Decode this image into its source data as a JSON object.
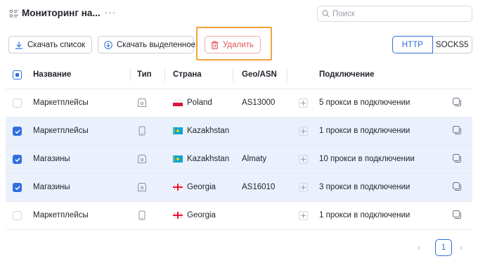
{
  "header": {
    "title": "Мониторинг на...",
    "more": "···",
    "search_placeholder": "Поиск"
  },
  "toolbar": {
    "download_list": "Скачать список",
    "download_selected": "Скачать выделенное",
    "delete": "Удалить",
    "protocols": [
      "HTTP",
      "SOCKS5"
    ],
    "active_protocol": "HTTP"
  },
  "table": {
    "columns": {
      "name": "Название",
      "type": "Тип",
      "country": "Страна",
      "geo": "Geo/ASN",
      "connection": "Подключение"
    },
    "rows": [
      {
        "name": "Маркетплейсы",
        "type_icon": "router-icon",
        "country": "Poland",
        "flag": "poland-flag-icon",
        "geo": "AS13000",
        "connection": "5 прокси в подключении",
        "selected": false
      },
      {
        "name": "Маркетплейсы",
        "type_icon": "mobile-icon",
        "country": "Kazakhstan",
        "flag": "kazakhstan-flag-icon",
        "geo": "",
        "connection": "1 прокси в подключении",
        "selected": true
      },
      {
        "name": "Магазины",
        "type_icon": "router-icon",
        "country": "Kazakhstan",
        "flag": "kazakhstan-flag-icon",
        "geo": "Almaty",
        "connection": "10 прокси в подключении",
        "selected": true
      },
      {
        "name": "Магазины",
        "type_icon": "router-icon",
        "country": "Georgia",
        "flag": "georgia-flag-icon",
        "geo": "AS16010",
        "connection": "3 прокси в подключении",
        "selected": true
      },
      {
        "name": "Маркетплейсы",
        "type_icon": "mobile-icon",
        "country": "Georgia",
        "flag": "georgia-flag-icon",
        "geo": "",
        "connection": "1 прокси в подключении",
        "selected": false
      }
    ]
  },
  "pagination": {
    "current_page": "1",
    "prev": "‹",
    "next": "›"
  },
  "colors": {
    "accent": "#2f6fde",
    "danger": "#e55353",
    "highlight": "#f2a33a",
    "selected_row": "#eaf1fd"
  }
}
